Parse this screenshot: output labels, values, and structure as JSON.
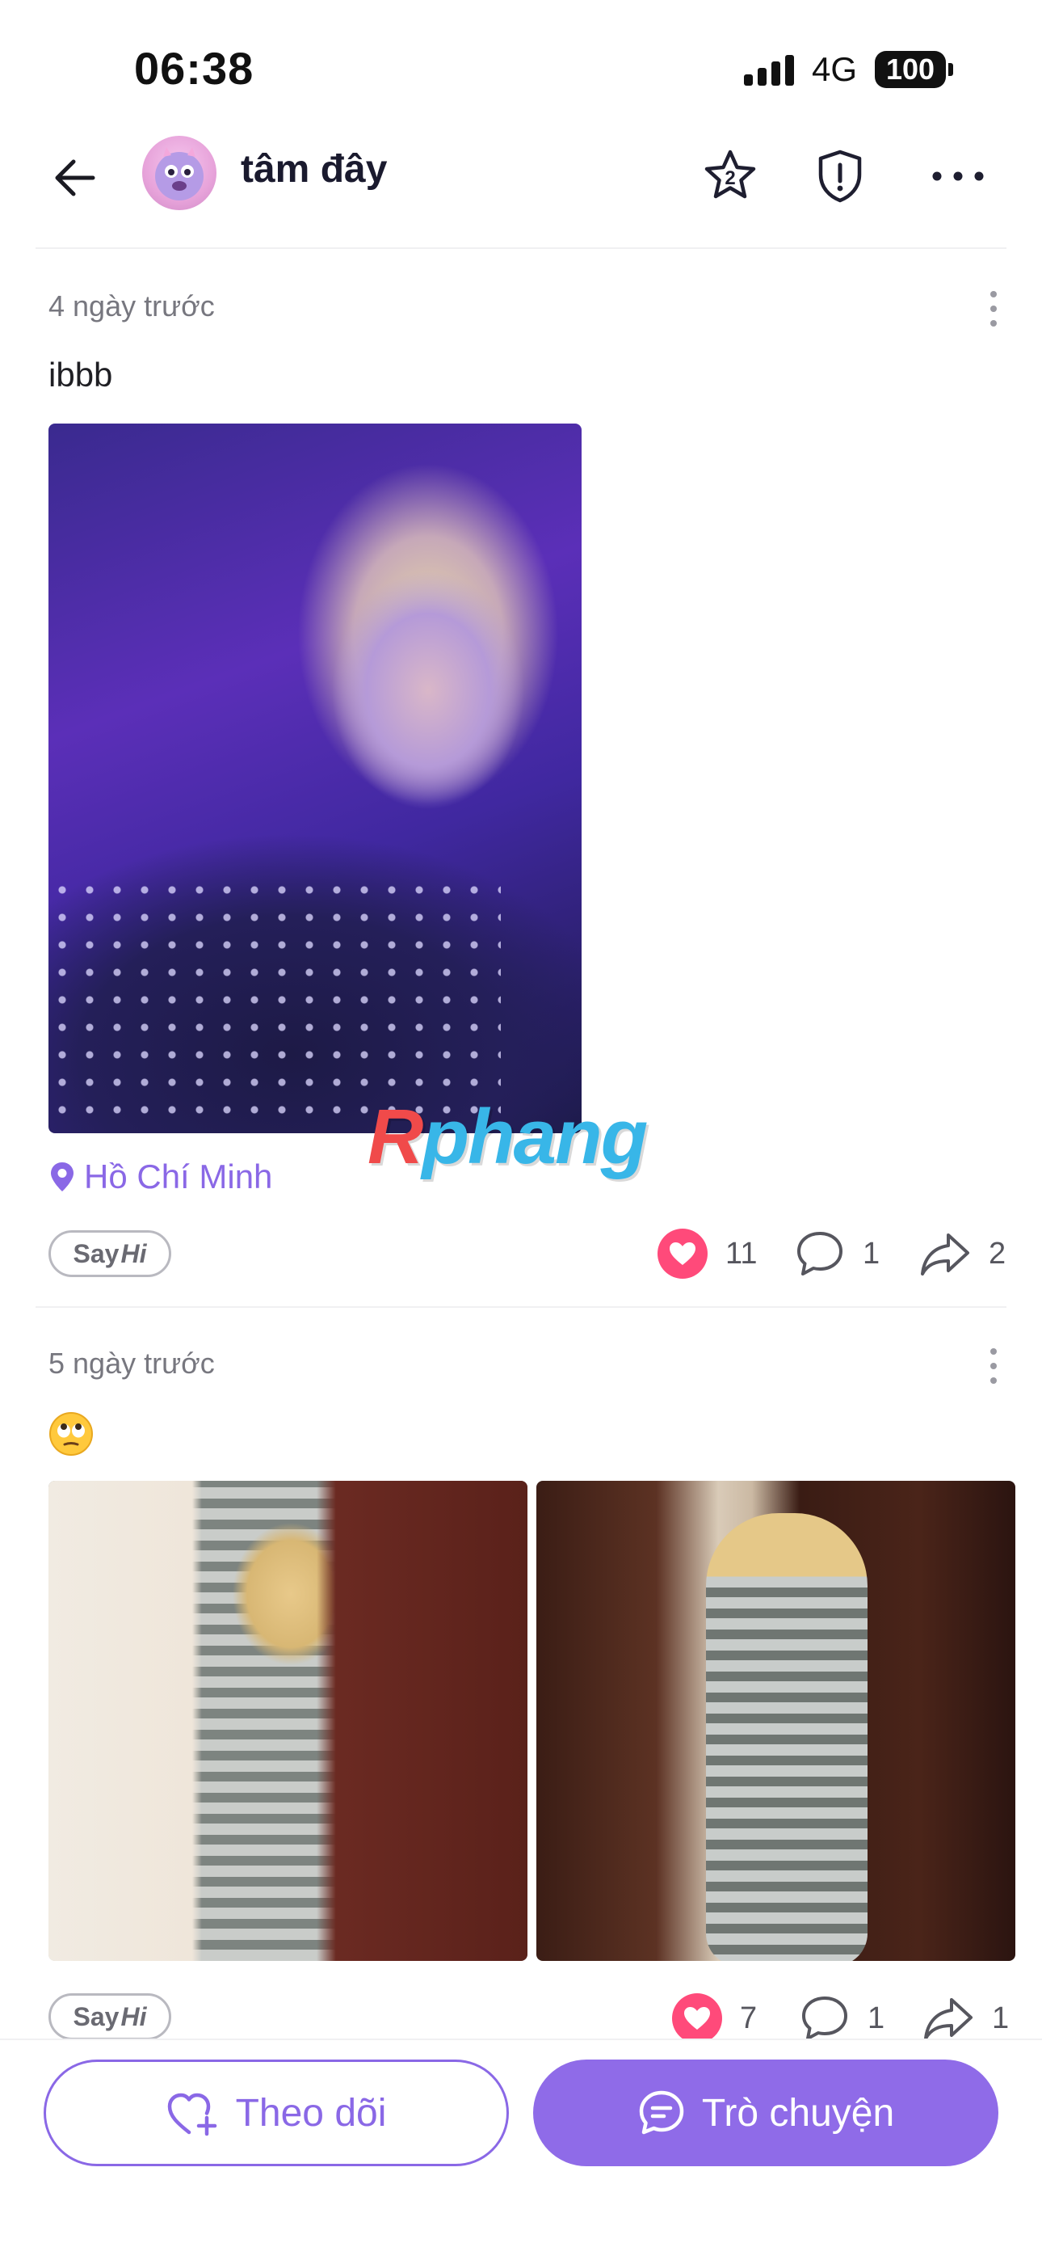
{
  "status_bar": {
    "time": "06:38",
    "network": "4G",
    "battery": "100"
  },
  "header": {
    "username": "tâm đây",
    "icons": [
      "back-arrow-icon",
      "star-badge-icon",
      "shield-alert-icon",
      "more-horizontal-icon"
    ],
    "star_badge_number": "2"
  },
  "posts": [
    {
      "time": "4 ngày trước",
      "text": "ibbb",
      "location": "Hồ Chí Minh",
      "say_hi": {
        "say": "Say",
        "hi": "Hi"
      },
      "likes": "11",
      "comments": "1",
      "shares": "2"
    },
    {
      "time": "5 ngày trước",
      "emoji": "face-with-rolling-eyes-icon",
      "say_hi": {
        "say": "Say",
        "hi": "Hi"
      },
      "likes": "7",
      "comments": "1",
      "shares": "1"
    }
  ],
  "watermark": {
    "part1": "R",
    "part2": "phang"
  },
  "bottom": {
    "follow_label": "Theo dõi",
    "chat_label": "Trò chuyện"
  },
  "colors": {
    "accent": "#8a68e6",
    "like": "#ff4a7a",
    "text_muted": "#77777f"
  }
}
